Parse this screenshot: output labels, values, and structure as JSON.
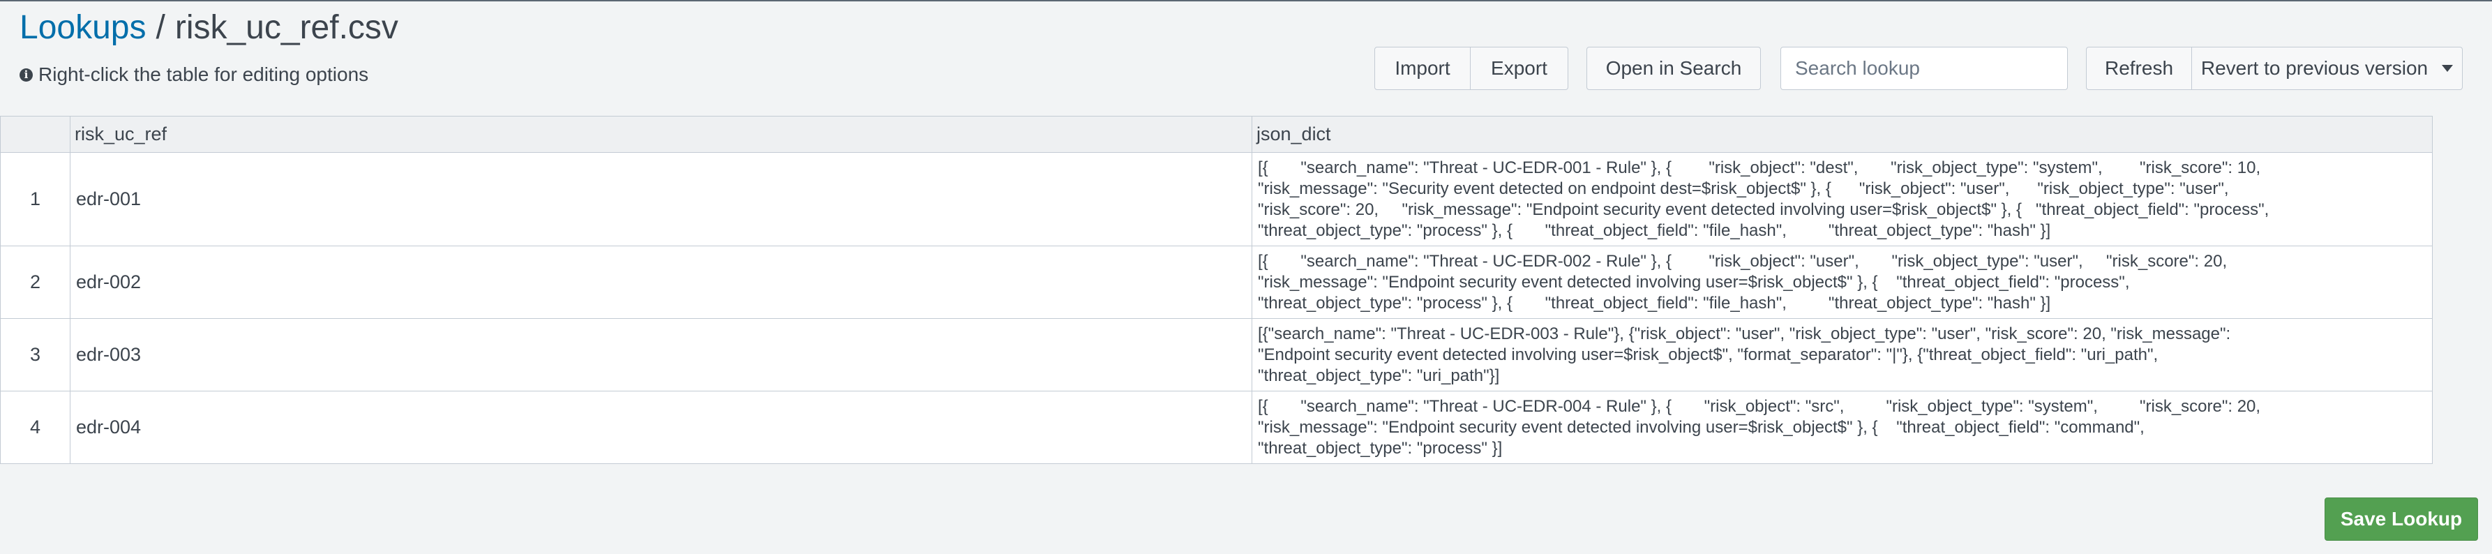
{
  "breadcrumb": {
    "parent": "Lookups",
    "separator": "/",
    "current": "risk_uc_ref.csv"
  },
  "hint": {
    "icon": "info-icon",
    "text": "Right-click the table for editing options"
  },
  "toolbar": {
    "import_label": "Import",
    "export_label": "Export",
    "open_in_search_label": "Open in Search",
    "search_placeholder": "Search lookup",
    "refresh_label": "Refresh",
    "revert_label": "Revert to previous version"
  },
  "table": {
    "columns": [
      "risk_uc_ref",
      "json_dict"
    ],
    "rows": [
      {
        "num": "1",
        "risk_uc_ref": "edr-001",
        "json_dict": "[{       \"search_name\": \"Threat - UC-EDR-001 - Rule\" }, {        \"risk_object\": \"dest\",       \"risk_object_type\": \"system\",        \"risk_score\": 10,\n\"risk_message\": \"Security event detected on endpoint dest=$risk_object$\" }, {      \"risk_object\": \"user\",      \"risk_object_type\": \"user\",\n\"risk_score\": 20,     \"risk_message\": \"Endpoint security event detected involving user=$risk_object$\" }, {   \"threat_object_field\": \"process\",\n\"threat_object_type\": \"process\" }, {       \"threat_object_field\": \"file_hash\",         \"threat_object_type\": \"hash\" }]"
      },
      {
        "num": "2",
        "risk_uc_ref": "edr-002",
        "json_dict": "[{       \"search_name\": \"Threat - UC-EDR-002 - Rule\" }, {        \"risk_object\": \"user\",       \"risk_object_type\": \"user\",     \"risk_score\": 20,\n\"risk_message\": \"Endpoint security event detected involving user=$risk_object$\" }, {    \"threat_object_field\": \"process\",\n\"threat_object_type\": \"process\" }, {       \"threat_object_field\": \"file_hash\",         \"threat_object_type\": \"hash\" }]"
      },
      {
        "num": "3",
        "risk_uc_ref": "edr-003",
        "json_dict": "[{\"search_name\": \"Threat - UC-EDR-003 - Rule\"}, {\"risk_object\": \"user\", \"risk_object_type\": \"user\", \"risk_score\": 20, \"risk_message\":\n\"Endpoint security event detected involving user=$risk_object$\", \"format_separator\": \"|\"}, {\"threat_object_field\": \"uri_path\",\n\"threat_object_type\": \"uri_path\"}]"
      },
      {
        "num": "4",
        "risk_uc_ref": "edr-004",
        "json_dict": "[{       \"search_name\": \"Threat - UC-EDR-004 - Rule\" }, {       \"risk_object\": \"src\",         \"risk_object_type\": \"system\",         \"risk_score\": 20,\n\"risk_message\": \"Endpoint security event detected involving user=$risk_object$\" }, {    \"threat_object_field\": \"command\",\n\"threat_object_type\": \"process\" }]"
      }
    ]
  },
  "footer": {
    "save_label": "Save Lookup"
  },
  "colors": {
    "link": "#006eaa",
    "save_button": "#53a051",
    "background": "#f2f4f5"
  }
}
